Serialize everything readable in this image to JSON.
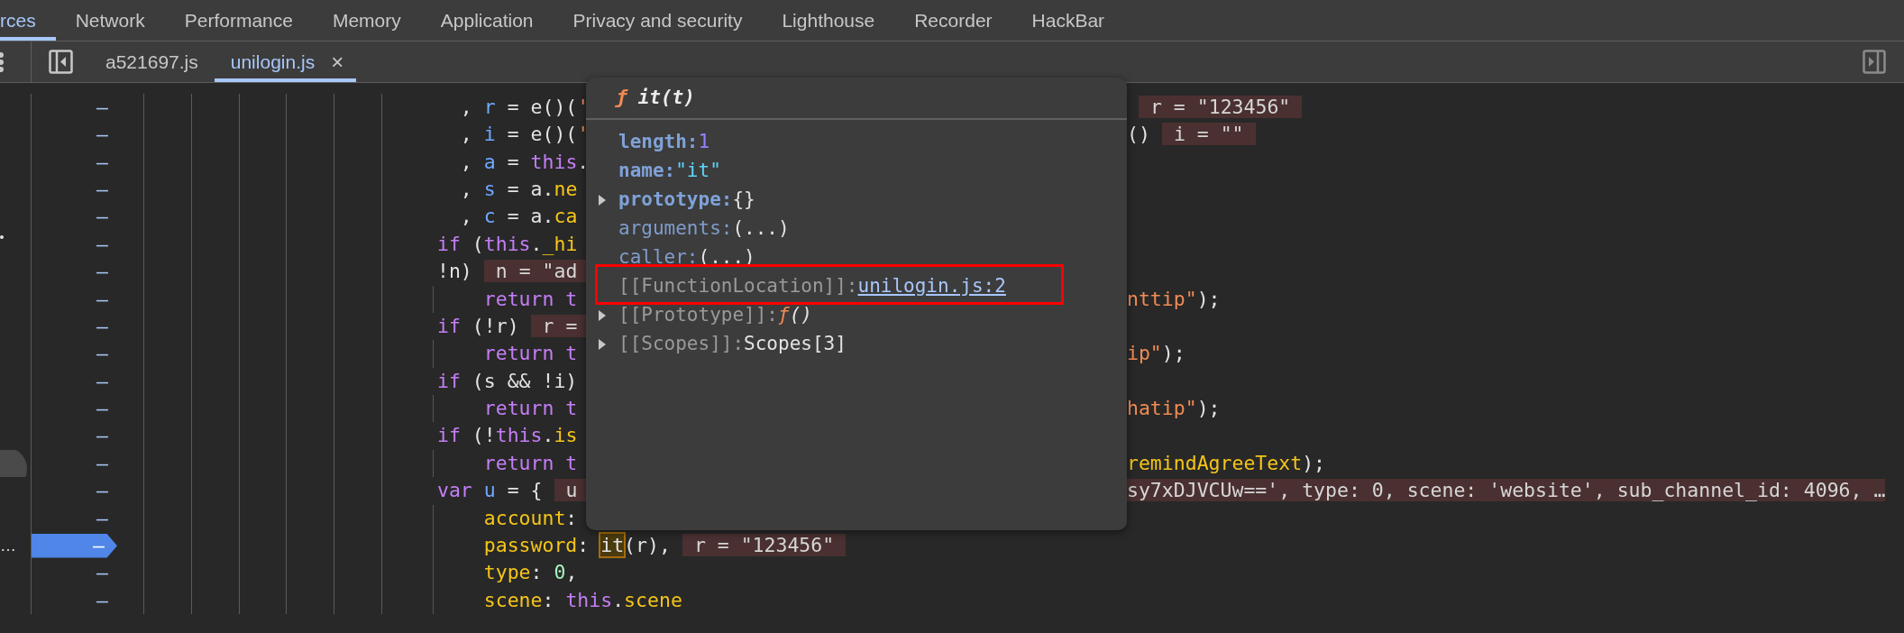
{
  "top_tabs": [
    {
      "label": "rces",
      "selected": true
    },
    {
      "label": "Network",
      "selected": false
    },
    {
      "label": "Performance",
      "selected": false
    },
    {
      "label": "Memory",
      "selected": false
    },
    {
      "label": "Application",
      "selected": false
    },
    {
      "label": "Privacy and security",
      "selected": false
    },
    {
      "label": "Lighthouse",
      "selected": false
    },
    {
      "label": "Recorder",
      "selected": false
    },
    {
      "label": "HackBar",
      "selected": false
    }
  ],
  "file_tabs": [
    {
      "label": "a521697.js",
      "selected": false,
      "closable": false
    },
    {
      "label": "unilogin.js",
      "selected": true,
      "closable": true,
      "close": "×"
    }
  ],
  "code_rows": [
    {
      "kind": "continuation",
      "line_number": "–",
      "left": [
        {
          "kind": "plain",
          "text": ", "
        },
        {
          "kind": "variable",
          "text": "r"
        },
        {
          "kind": "plain",
          "text": " = e()("
        },
        {
          "kind": "string",
          "text": "'"
        }
      ],
      "right": [
        {
          "kind": "value",
          "text": "r = \"123456\""
        }
      ]
    },
    {
      "kind": "continuation",
      "line_number": "–",
      "left": [
        {
          "kind": "plain",
          "text": ", "
        },
        {
          "kind": "variable",
          "text": "i"
        },
        {
          "kind": "plain",
          "text": " = e()("
        },
        {
          "kind": "string",
          "text": "'"
        }
      ],
      "right": [
        {
          "kind": "plain",
          "text": "()"
        },
        {
          "kind": "value",
          "text": "i = \"\""
        }
      ]
    },
    {
      "kind": "continuation",
      "line_number": "–",
      "left": [
        {
          "kind": "plain",
          "text": ", "
        },
        {
          "kind": "variable",
          "text": "a"
        },
        {
          "kind": "plain",
          "text": " = "
        },
        {
          "kind": "keyword",
          "text": "this"
        },
        {
          "kind": "plain",
          "text": "."
        }
      ]
    },
    {
      "kind": "continuation",
      "line_number": "–",
      "left": [
        {
          "kind": "plain",
          "text": ", "
        },
        {
          "kind": "variable",
          "text": "s"
        },
        {
          "kind": "plain",
          "text": " = a."
        },
        {
          "kind": "property",
          "text": "ne"
        }
      ]
    },
    {
      "kind": "continuation",
      "line_number": "–",
      "left": [
        {
          "kind": "plain",
          "text": ", "
        },
        {
          "kind": "variable",
          "text": "c"
        },
        {
          "kind": "plain",
          "text": " = a."
        },
        {
          "kind": "property",
          "text": "ca"
        }
      ]
    },
    {
      "kind": "statement",
      "line_number": "–",
      "edge": {
        "kind": "dot"
      },
      "left": [
        {
          "kind": "keyword",
          "text": "if"
        },
        {
          "kind": "plain",
          "text": " ("
        },
        {
          "kind": "keyword",
          "text": "this"
        },
        {
          "kind": "plain",
          "text": "."
        },
        {
          "kind": "property",
          "text": "_hi"
        }
      ]
    },
    {
      "kind": "statement",
      "line_number": "–",
      "left": [
        {
          "kind": "plain",
          "text": "!n)"
        },
        {
          "kind": "value",
          "text": "n = \"ad"
        }
      ]
    },
    {
      "kind": "body",
      "line_number": "–",
      "left": [
        {
          "kind": "keyword",
          "text": "return t"
        }
      ],
      "right": [
        {
          "kind": "string",
          "text": "nttip\""
        },
        {
          "kind": "plain",
          "text": ");"
        }
      ]
    },
    {
      "kind": "statement",
      "line_number": "–",
      "left": [
        {
          "kind": "keyword",
          "text": "if"
        },
        {
          "kind": "plain",
          "text": " (!r)"
        },
        {
          "kind": "value",
          "text": "r ="
        }
      ]
    },
    {
      "kind": "body",
      "line_number": "–",
      "left": [
        {
          "kind": "keyword",
          "text": "return t"
        }
      ],
      "right": [
        {
          "kind": "string",
          "text": "ip\""
        },
        {
          "kind": "plain",
          "text": ");"
        }
      ]
    },
    {
      "kind": "statement",
      "line_number": "–",
      "left": [
        {
          "kind": "keyword",
          "text": "if"
        },
        {
          "kind": "plain",
          "text": " (s && !i)"
        }
      ]
    },
    {
      "kind": "body",
      "line_number": "–",
      "left": [
        {
          "kind": "keyword",
          "text": "return t"
        }
      ],
      "right": [
        {
          "kind": "string",
          "text": "hatip\""
        },
        {
          "kind": "plain",
          "text": ");"
        }
      ]
    },
    {
      "kind": "statement",
      "line_number": "–",
      "left": [
        {
          "kind": "keyword",
          "text": "if"
        },
        {
          "kind": "plain",
          "text": " (!"
        },
        {
          "kind": "keyword",
          "text": "this"
        },
        {
          "kind": "plain",
          "text": "."
        },
        {
          "kind": "property",
          "text": "is"
        }
      ]
    },
    {
      "kind": "body",
      "line_number": "–",
      "edge": {
        "kind": "handle"
      },
      "left": [
        {
          "kind": "keyword",
          "text": "return t"
        }
      ],
      "right": [
        {
          "kind": "property",
          "text": "remindAgreeText"
        },
        {
          "kind": "plain",
          "text": ");"
        }
      ]
    },
    {
      "kind": "statement",
      "line_number": "–",
      "left": [
        {
          "kind": "keyword",
          "text": "var "
        },
        {
          "kind": "variable",
          "text": "u"
        },
        {
          "kind": "plain",
          "text": " = {"
        },
        {
          "kind": "value",
          "text": "u"
        }
      ],
      "right": [
        {
          "kind": "value_tail",
          "text": "sy7xDJVCUw==', type: 0, scene: 'website', sub_channel_id: 4096, …"
        }
      ]
    },
    {
      "kind": "body",
      "line_number": "–",
      "left": [
        {
          "kind": "property",
          "text": "account"
        },
        {
          "kind": "plain",
          "text": ":"
        }
      ]
    },
    {
      "kind": "body",
      "line_number": "–",
      "breakpoint": true,
      "edge": {
        "kind": "text",
        "text": "…"
      },
      "left": [
        {
          "kind": "property",
          "text": "password"
        },
        {
          "kind": "plain",
          "text": ": "
        },
        {
          "kind": "hovered",
          "text": "it"
        },
        {
          "kind": "plain",
          "text": "(r),"
        },
        {
          "kind": "value",
          "text": "r = \"123456\""
        }
      ]
    },
    {
      "kind": "body",
      "line_number": "–",
      "left": [
        {
          "kind": "property",
          "text": "type"
        },
        {
          "kind": "plain",
          "text": ": "
        },
        {
          "kind": "number",
          "text": "0"
        },
        {
          "kind": "plain",
          "text": ","
        }
      ]
    },
    {
      "kind": "body",
      "line_number": "–",
      "left": [
        {
          "kind": "property",
          "text": "scene"
        },
        {
          "kind": "plain",
          "text": ": "
        },
        {
          "kind": "keyword",
          "text": "this"
        },
        {
          "kind": "plain",
          "text": "."
        },
        {
          "kind": "property",
          "text": "scene"
        }
      ]
    }
  ],
  "popover": {
    "mark": "ƒ",
    "signature": "it(t)",
    "properties": [
      {
        "key": "length:",
        "kind": "number",
        "value": "1",
        "expandable": false,
        "highlighted": false
      },
      {
        "key": "name:",
        "kind": "string",
        "value": "\"it\"",
        "expandable": false,
        "highlighted": false
      },
      {
        "key": "prototype:",
        "kind": "object",
        "value": "{}",
        "expandable": true,
        "highlighted": false
      },
      {
        "key": "arguments:",
        "kind": "accessor",
        "value": "(...)",
        "expandable": false,
        "highlighted": false
      },
      {
        "key": "caller:",
        "kind": "accessor",
        "value": "(...)",
        "expandable": false,
        "highlighted": false
      },
      {
        "key": "[[FunctionLocation]]:",
        "kind": "location",
        "value": "unilogin.js:2",
        "expandable": false,
        "highlighted": true
      },
      {
        "key": "[[Prototype]]:",
        "kind": "function",
        "mark": "ƒ",
        "value": "()",
        "expandable": true,
        "highlighted": false
      },
      {
        "key": "[[Scopes]]:",
        "kind": "internal",
        "value": "Scopes[3]",
        "expandable": true,
        "highlighted": false
      }
    ]
  }
}
